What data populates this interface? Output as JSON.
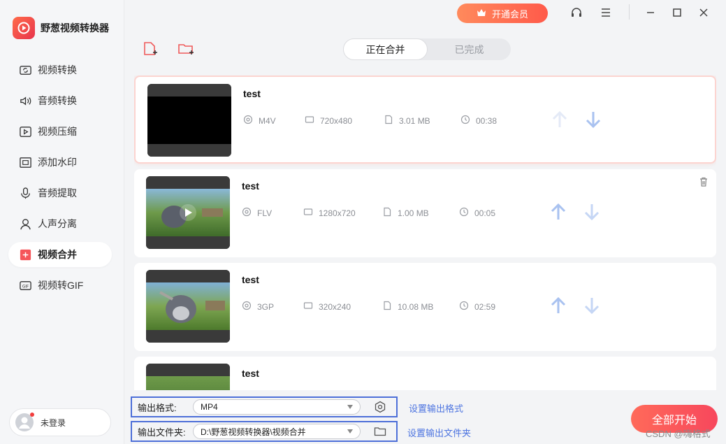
{
  "app": {
    "title": "野葱视频转换器",
    "vip_label": "开通会员"
  },
  "sidebar": {
    "items": [
      {
        "label": "视频转换",
        "icon": "video-convert-icon"
      },
      {
        "label": "音频转换",
        "icon": "audio-convert-icon"
      },
      {
        "label": "视频压缩",
        "icon": "video-compress-icon"
      },
      {
        "label": "添加水印",
        "icon": "watermark-icon"
      },
      {
        "label": "音频提取",
        "icon": "audio-extract-icon"
      },
      {
        "label": "人声分离",
        "icon": "voice-separate-icon"
      },
      {
        "label": "视频合并",
        "icon": "video-merge-icon",
        "active": true
      },
      {
        "label": "视频转GIF",
        "icon": "gif-icon"
      }
    ],
    "user_label": "未登录"
  },
  "tabs": [
    {
      "label": "正在合并",
      "active": true
    },
    {
      "label": "已完成",
      "active": false
    }
  ],
  "files": [
    {
      "title": "test",
      "format": "M4V",
      "resolution": "720x480",
      "size": "3.01 MB",
      "duration": "00:38",
      "selected": true
    },
    {
      "title": "test",
      "format": "FLV",
      "resolution": "1280x720",
      "size": "1.00 MB",
      "duration": "00:05",
      "selected": false
    },
    {
      "title": "test",
      "format": "3GP",
      "resolution": "320x240",
      "size": "10.08 MB",
      "duration": "02:59",
      "selected": false
    },
    {
      "title": "test"
    }
  ],
  "output": {
    "format_label": "输出格式:",
    "format_value": "MP4",
    "format_link": "设置输出格式",
    "folder_label": "输出文件夹:",
    "folder_value": "D:\\野葱视频转换器\\视频合并",
    "folder_link": "设置输出文件夹"
  },
  "start_label": "全部开始",
  "watermark": "CSDN @嗨格式",
  "colors": {
    "accent": "#f7475c",
    "link": "#4d74e0",
    "highlight_border": "#4d6fd8"
  }
}
